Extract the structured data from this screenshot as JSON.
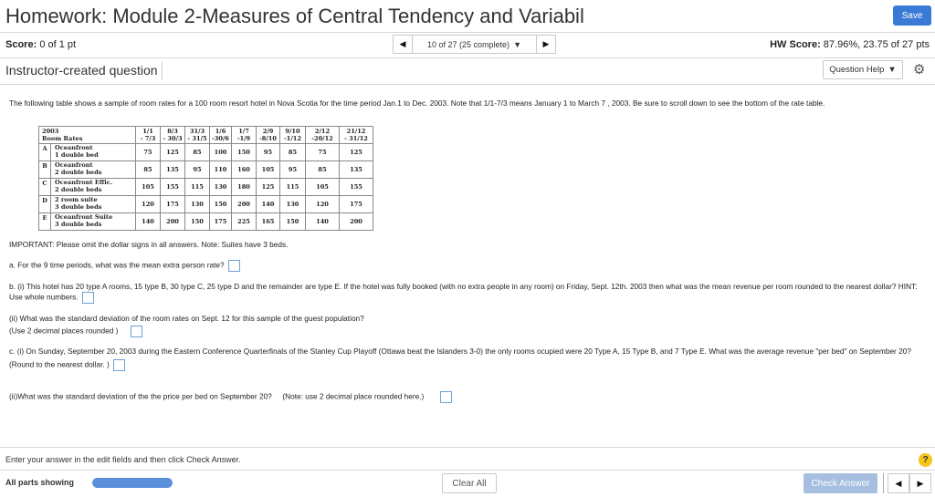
{
  "header": {
    "title": "Homework: Module 2-Measures of Central Tendency and Variabil",
    "save_label": "Save"
  },
  "score_bar": {
    "score_label": "Score:",
    "score_value": "0 of 1 pt",
    "nav_label": "10 of 27 (25 complete)",
    "prev_icon": "◀",
    "next_icon": "▶",
    "dropdown_icon": "▼",
    "hw_score_label": "HW Score:",
    "hw_score_value": "87.96%, 23.75 of 27 pts"
  },
  "question_header": {
    "instructor_label": "Instructor-created question",
    "help_label": "Question Help",
    "help_icon": "▼",
    "settings_icon": "gear-icon"
  },
  "intro_text": "The following table shows a sample of room rates for a 100 room  resort hotel in Nova Scotia  for the time period Jan.1 to Dec. 2003.  Note that 1/1-7/3 means January 1 to  March 7 , 2003.  Be sure to scroll down to see the bottom of the rate table.",
  "rate_table": {
    "header_line1": "2003",
    "header_line2": "Room Rates",
    "periods": [
      {
        "l1": "1/1",
        "l2": "- 7/3"
      },
      {
        "l1": "8/3",
        "l2": "- 30/3"
      },
      {
        "l1": "31/3",
        "l2": "- 31/5"
      },
      {
        "l1": "1/6",
        "l2": "-30/6"
      },
      {
        "l1": "1/7",
        "l2": "-1/9"
      },
      {
        "l1": "2/9",
        "l2": "-8/10"
      },
      {
        "l1": "9/10",
        "l2": "-1/12"
      },
      {
        "l1": "2/12",
        "l2": "-20/12"
      },
      {
        "l1": "21/12",
        "l2": "- 31/12"
      }
    ],
    "rows": [
      {
        "letter": "A",
        "room_l1": "Oceanfront",
        "room_l2": "1 double bed",
        "values": [
          "75",
          "125",
          "85",
          "100",
          "150",
          "95",
          "85",
          "75",
          "125"
        ]
      },
      {
        "letter": "B",
        "room_l1": "Oceanfront",
        "room_l2": "2 double beds",
        "values": [
          "85",
          "135",
          "95",
          "110",
          "160",
          "105",
          "95",
          "85",
          "135"
        ]
      },
      {
        "letter": "C",
        "room_l1": "Oceanfront Effic.",
        "room_l2": "2 double beds",
        "values": [
          "105",
          "155",
          "115",
          "130",
          "180",
          "125",
          "115",
          "105",
          "155"
        ]
      },
      {
        "letter": "D",
        "room_l1": "2 room suite",
        "room_l2": "3 double beds",
        "values": [
          "120",
          "175",
          "130",
          "150",
          "200",
          "140",
          "130",
          "120",
          "175"
        ]
      },
      {
        "letter": "E",
        "room_l1": "Oceanfront Suite",
        "room_l2": "3 double beds",
        "values": [
          "140",
          "200",
          "150",
          "175",
          "225",
          "165",
          "150",
          "140",
          "200"
        ]
      }
    ]
  },
  "questions": {
    "important": "IMPORTANT: Please omit the dollar signs in all answers.  Note: Suites have 3 beds.",
    "a": "a. For the 9 time periods, what was the mean extra person rate?",
    "b1": "b. (i) This hotel has 20 type A rooms, 15 type B, 30 type C, 25 type D and the remainder are type E.  If the hotel was fully booked (with no extra people in any room) on Friday, Sept. 12th. 2003 then what was the mean revenue per room rounded to the nearest dollar? HINT: Use whole numbers.",
    "b2_l1": "(ii) What was the standard deviation of the room rates on Sept. 12 for this sample of the guest population?",
    "b2_l2": " (Use 2 decimal places rounded  )",
    "c1_l1": "c. (i)  On Sunday, September 20, 2003 during the Eastern Conference Quarterfinals of the Stanley Cup Playoff  (Ottawa  beat the Islanders 3-0) the only rooms ocupied were 20 Type A, 15 Type B, and 7 Type E. What was the average revenue \"per bed\" on September 20?",
    "c1_l2": " (Round to the nearest dollar. )",
    "c2": "(ii)What was the standard deviation of the the price per bed on September 20?     (Note: use 2 decimal place rounded here.)"
  },
  "footer": {
    "hint_text": "Enter your answer in the edit fields and then click Check Answer.",
    "help_icon": "?",
    "parts_label": "All parts showing",
    "progress": 1.0,
    "clear_label": "Clear All",
    "check_label": "Check Answer",
    "prev_icon": "◀",
    "next_icon": "▶"
  },
  "colors": {
    "accent": "#3a7ad6",
    "progress_fill": "#5b8edb",
    "check_disabled": "#a6bfe0",
    "help_yellow": "#f4c418"
  }
}
